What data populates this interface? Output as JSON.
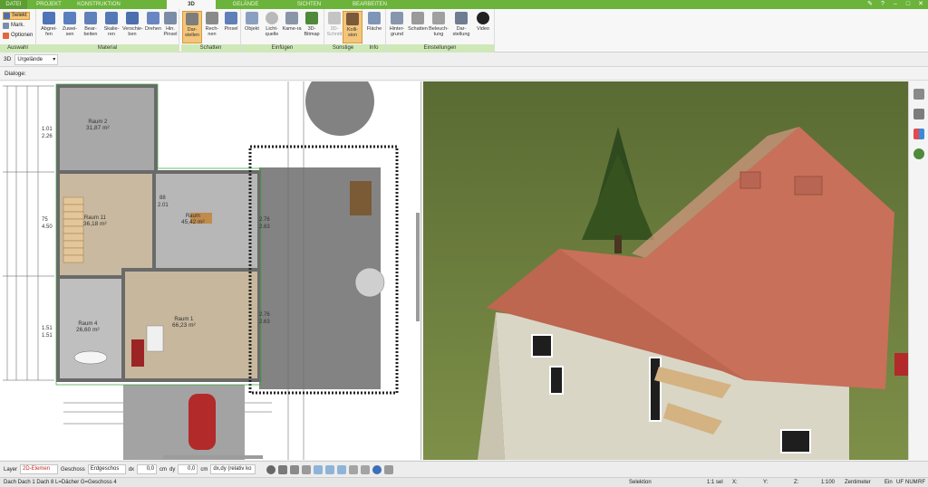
{
  "tabs": [
    {
      "label": "DATEI"
    },
    {
      "label": "PROJEKT"
    },
    {
      "label": "KONSTRUKTION"
    },
    {
      "label": "3D"
    },
    {
      "label": "GELÄNDE"
    },
    {
      "label": "SICHTEN"
    },
    {
      "label": "BEARBEITEN"
    }
  ],
  "active_tab": "3D",
  "ribbon": {
    "auswahl": {
      "label": "Auswahl",
      "items": [
        "Selekt",
        "Mark.",
        "Optionen"
      ]
    },
    "material": {
      "label": "Material",
      "buttons": [
        "Abgrei-fen",
        "Zuwei-sen",
        "Bear-beiten",
        "Skalie-ren",
        "Verschie-ben",
        "Drehen",
        "Hin. Pinsel"
      ]
    },
    "schatten": {
      "label": "Schatten",
      "buttons": [
        "Dar-stellen",
        "Rech-nen",
        "Pinsel"
      ]
    },
    "einfuegen": {
      "label": "Einfügen",
      "buttons": [
        "Objekt",
        "Licht-quelle",
        "Kame-ra",
        "3D-Bitmap"
      ]
    },
    "sonstige": {
      "label": "Sonstige",
      "buttons": [
        "3D-Schnitt",
        "Kolli-sion"
      ]
    },
    "info": {
      "label": "Info",
      "buttons": [
        "Fläche"
      ]
    },
    "einstellungen": {
      "label": "Einstellungen",
      "buttons": [
        "Hinter-grund",
        "Schatten",
        "Beleuch-tung",
        "Dar-stellung",
        "Video"
      ]
    }
  },
  "subbar": {
    "view_label": "3D",
    "view_select": "Urgelände"
  },
  "dialog_label": "Dialoge:",
  "plan": {
    "rooms": [
      {
        "name": "Raum 2",
        "area": "31,87 m²"
      },
      {
        "name": "Raum 11",
        "area": "36,18 m²"
      },
      {
        "name": "Raum",
        "area": "45,42 m²"
      },
      {
        "name": "Raum 4",
        "area": "26,60 m²"
      },
      {
        "name": "Raum 1",
        "area": "66,23 m²"
      }
    ],
    "dims": [
      "1.01",
      "2.26",
      "75",
      "4.50",
      "1.51",
      "1.51",
      "2.76",
      "2.63",
      "2.76",
      "2.63",
      "88",
      "2.01"
    ]
  },
  "layerbar": {
    "layer_label": "Layer",
    "layer_value": "2D-Elemen",
    "geschoss_label": "Geschoss",
    "geschoss_value": "Erdgeschos",
    "dx_label": "dx",
    "dx_value": "0,0",
    "dx_unit": "cm",
    "dy_label": "dy",
    "dy_value": "0,0",
    "dy_unit": "cm",
    "mode_value": "dx,dy (relativ ko"
  },
  "status": {
    "left": "Dach Dach 1 Dach 8 L=Dächer G=Geschoss 4",
    "selektion": "Selektion",
    "sel_count": "1:1 sel",
    "x": "X:",
    "y": "Y:",
    "z": "Z:",
    "scale": "1:100",
    "unit": "Zentimeter",
    "ein": "Ein",
    "uf": "UF",
    "num": "NUM",
    "rf": "RF"
  },
  "colors": {
    "accent": "#6bb33b",
    "ribbon_group": "#cfe8b8",
    "selected": "#f3c57a",
    "roof": "#c8705a",
    "grass": "#6c7d3e"
  }
}
